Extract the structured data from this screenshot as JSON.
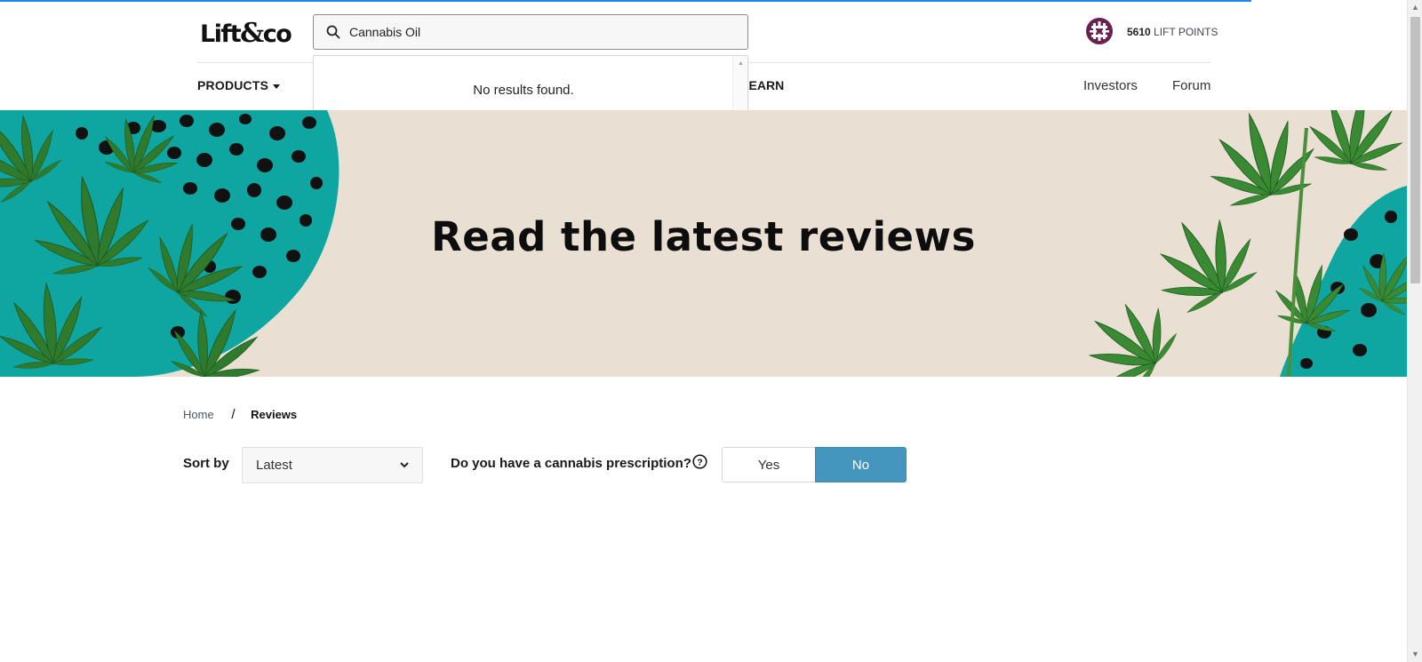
{
  "header": {
    "logo": {
      "left": "Lift",
      "amp": "&",
      "right": "co"
    },
    "search": {
      "value": "Cannabis Oil",
      "placeholder": ""
    },
    "points": {
      "value": "5610",
      "label": "LIFT POINTS"
    },
    "nav": {
      "products_label": "PRODUCTS",
      "learn_label": "LEARN",
      "investors_label": "Investors",
      "forum_label": "Forum"
    }
  },
  "autocomplete": {
    "message": "No results found."
  },
  "hero": {
    "title": "Read the latest reviews"
  },
  "breadcrumb": {
    "home": "Home",
    "separator": "/",
    "current": "Reviews"
  },
  "filters": {
    "sort_label": "Sort by",
    "sort_value": "Latest",
    "prescription_question": "Do you have a cannabis prescription?",
    "yes_label": "Yes",
    "no_label": "No",
    "selected": "No"
  },
  "colors": {
    "accent_blue": "#4596bf",
    "hero_bg": "#eadfd3",
    "teal": "#0fa5a0",
    "badge_purple": "#6b2150",
    "loading_bar": "#1e88e5"
  },
  "icons": {
    "search": "search-icon",
    "points_badge": "lift-points-badge-icon",
    "help": "question-circle-icon",
    "select_chevron": "chevron-down-icon",
    "dropdown_caret": "caret-down-icon"
  }
}
